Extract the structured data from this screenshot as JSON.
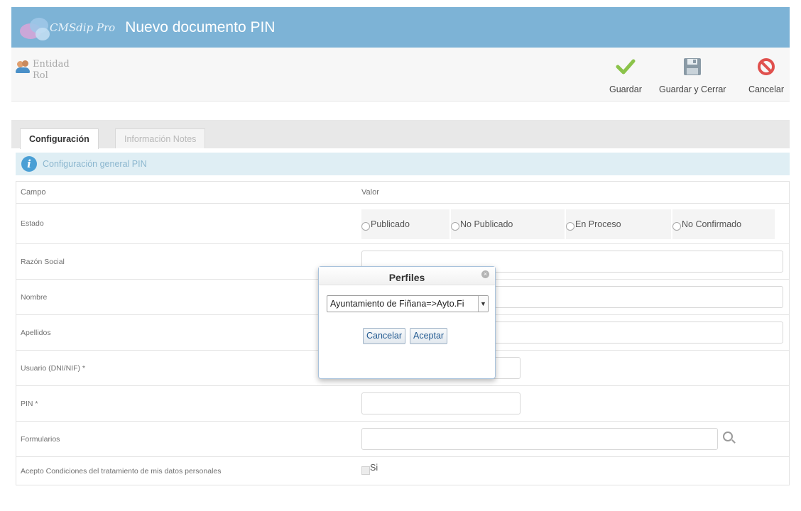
{
  "header": {
    "logo_text": "CMSdip Pro",
    "title": "Nuevo documento PIN"
  },
  "entity": {
    "line1": "Entidad",
    "line2": "Rol"
  },
  "toolbar": {
    "save_label": "Guardar",
    "save_close_label": "Guardar y Cerrar",
    "cancel_label": "Cancelar"
  },
  "tabs": [
    {
      "label": "Configuración",
      "active": true
    },
    {
      "label": "Información Notes",
      "active": false
    }
  ],
  "info": {
    "text": "Configuración general PIN"
  },
  "table": {
    "headers": [
      "Campo",
      "Valor"
    ],
    "estado": {
      "label": "Estado",
      "options": [
        "Publicado",
        "No Publicado",
        "En Proceso",
        "No Confirmado"
      ]
    },
    "rows": [
      {
        "label": "Razón Social"
      },
      {
        "label": "Nombre"
      },
      {
        "label": "Apellidos"
      },
      {
        "label": "Usuario (DNI/NIF) *"
      },
      {
        "label": "PIN *"
      },
      {
        "label": "Formularios"
      },
      {
        "label": "Acepto Condiciones del tratamiento de mis datos personales",
        "checkbox_label": "Si"
      }
    ]
  },
  "dialog": {
    "title": "Perfiles",
    "select_value": "Ayuntamiento de Fiñana=>Ayto.Fi",
    "cancel_label": "Cancelar",
    "accept_label": "Aceptar"
  },
  "colors": {
    "header_bg": "#7db3d6",
    "info_bg": "#dfeef4",
    "save_check": "#8bc34a",
    "cancel_icon": "#e0504d"
  }
}
